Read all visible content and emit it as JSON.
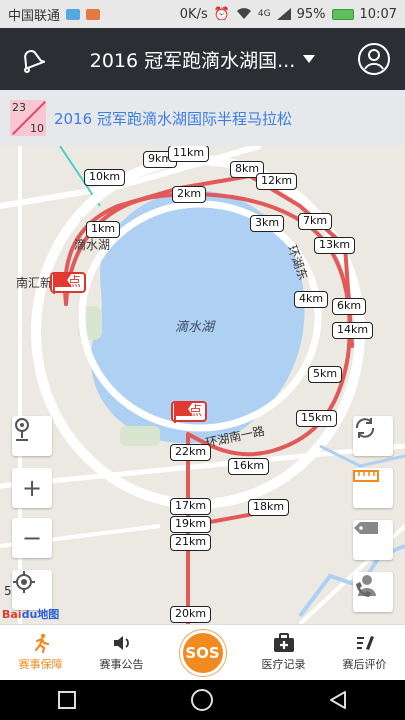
{
  "status_bar": {
    "carrier": "中国联通",
    "network_speed": "0K/s",
    "signal": "4G",
    "battery": "95%",
    "time": "10:07"
  },
  "header": {
    "title": "2016 冠军跑滴水湖国...",
    "bell_icon": "bell-icon",
    "profile_icon": "user-icon"
  },
  "event": {
    "date_top": "23",
    "date_bottom": "10",
    "title": "2016 冠军跑滴水湖国际半程马拉松"
  },
  "map": {
    "lake_name": "滴水湖",
    "place_label": "滴水湖",
    "district_label": "南汇新",
    "road_label_1": "环湖东",
    "road_label_2": "环湖南一路",
    "start_label": "起点",
    "finish_label": "终点",
    "zoom_level": "5",
    "logo_text": "Bai",
    "logo_text_2": "du",
    "logo_text_3": "地图",
    "km_markers": [
      "1km",
      "2km",
      "3km",
      "4km",
      "5km",
      "6km",
      "7km",
      "8km",
      "9km",
      "10km",
      "11km",
      "12km",
      "13km",
      "14km",
      "15km",
      "16km",
      "17km",
      "18km",
      "19km",
      "20km",
      "21km",
      "22km"
    ],
    "route_color": "#e05a5a",
    "lake_color": "#aed0f2"
  },
  "map_controls": {
    "location_pin": "pin-icon",
    "zoom_in": "+",
    "zoom_out": "−",
    "locate": "crosshair-icon",
    "refresh": "refresh-icon",
    "ruler": "ruler-icon",
    "tag": "tag-icon",
    "contact": "phone-contact-icon"
  },
  "bottom_nav": {
    "items": [
      {
        "label": "赛事保障",
        "icon": "runner-icon"
      },
      {
        "label": "赛事公告",
        "icon": "speaker-icon"
      },
      {
        "label": "SOS",
        "icon": "sos-icon"
      },
      {
        "label": "医疗记录",
        "icon": "medkit-icon"
      },
      {
        "label": "赛后评价",
        "icon": "edit-icon"
      }
    ],
    "active_color": "#f18a1f"
  }
}
